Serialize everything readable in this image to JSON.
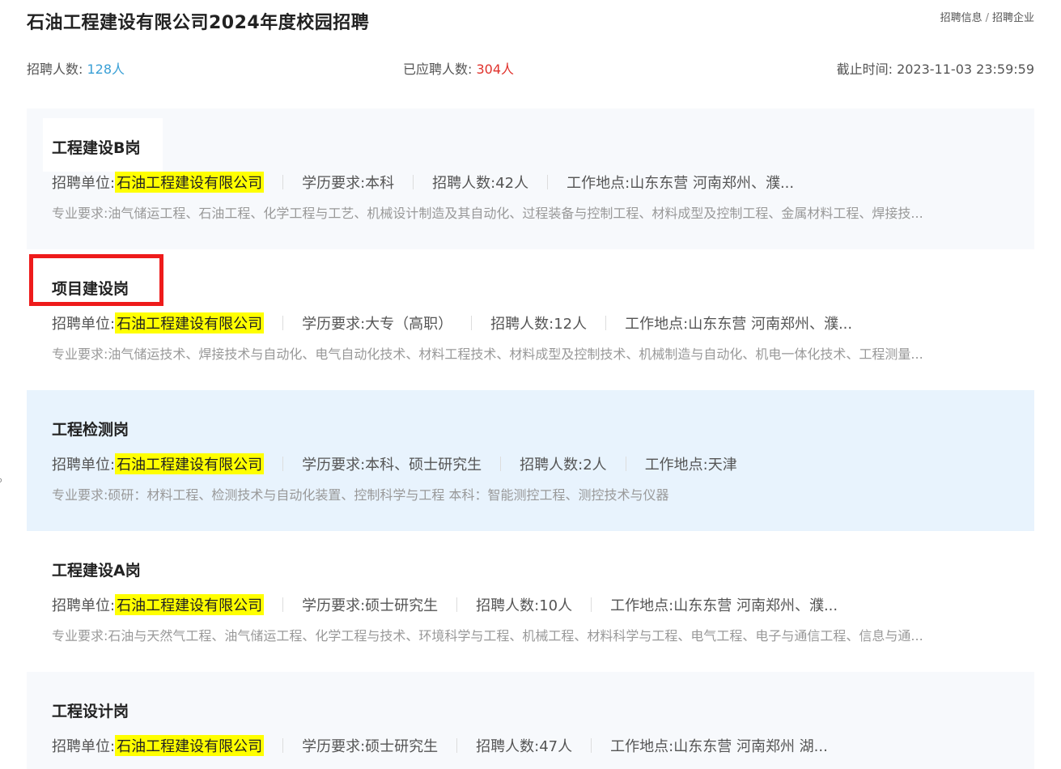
{
  "page": {
    "title": "石油工程建设有限公司2024年度校园招聘",
    "breadcrumb": [
      "招聘信息",
      "招聘企业"
    ],
    "breadcrumb_sep": "/"
  },
  "stats": {
    "recruit_label": "招聘人数:",
    "recruit_value": "128人",
    "applied_label": "已应聘人数:",
    "applied_value": "304人",
    "deadline_label": "截止时间:",
    "deadline_value": "2023-11-03 23:59:59"
  },
  "labels": {
    "unit": "招聘单位:",
    "edu": "学历要求:",
    "count": "招聘人数:",
    "location": "工作地点:",
    "major": "专业要求:"
  },
  "jobs": [
    {
      "title": "工程建设B岗",
      "unit": "石油工程建设有限公司",
      "edu": "本科",
      "count": "42人",
      "location": "山东东营 河南郑州、濮...",
      "major": "油气储运工程、石油工程、化学工程与工艺、机械设计制造及其自动化、过程装备与控制工程、材料成型及控制工程、金属材料工程、焊接技..."
    },
    {
      "title": "项目建设岗",
      "unit": "石油工程建设有限公司",
      "edu": "大专（高职）",
      "count": "12人",
      "location": "山东东营 河南郑州、濮...",
      "major": "油气储运技术、焊接技术与自动化、电气自动化技术、材料工程技术、材料成型及控制技术、机械制造与自动化、机电一体化技术、工程测量..."
    },
    {
      "title": "工程检测岗",
      "unit": "石油工程建设有限公司",
      "edu": "本科、硕士研究生",
      "count": "2人",
      "location": "天津",
      "major": "硕研：材料工程、检测技术与自动化装置、控制科学与工程 本科：智能测控工程、测控技术与仪器"
    },
    {
      "title": "工程建设A岗",
      "unit": "石油工程建设有限公司",
      "edu": "硕士研究生",
      "count": "10人",
      "location": "山东东营 河南郑州、濮...",
      "major": "石油与天然气工程、油气储运工程、化学工程与技术、环境科学与工程、机械工程、材料科学与工程、电气工程、电子与通信工程、信息与通..."
    },
    {
      "title": "工程设计岗",
      "unit": "石油工程建设有限公司",
      "edu": "硕士研究生",
      "count": "47人",
      "location": "山东东营 河南郑州 湖...",
      "major": ""
    }
  ],
  "colors": {
    "highlight_box": "#ee1b1b",
    "company_highlight": "#ffff00",
    "recruit_value": "#3aa0d6",
    "applied_value": "#e0322c",
    "card_blue": "#e8f3fd",
    "card_grey": "#f7f9fc"
  }
}
